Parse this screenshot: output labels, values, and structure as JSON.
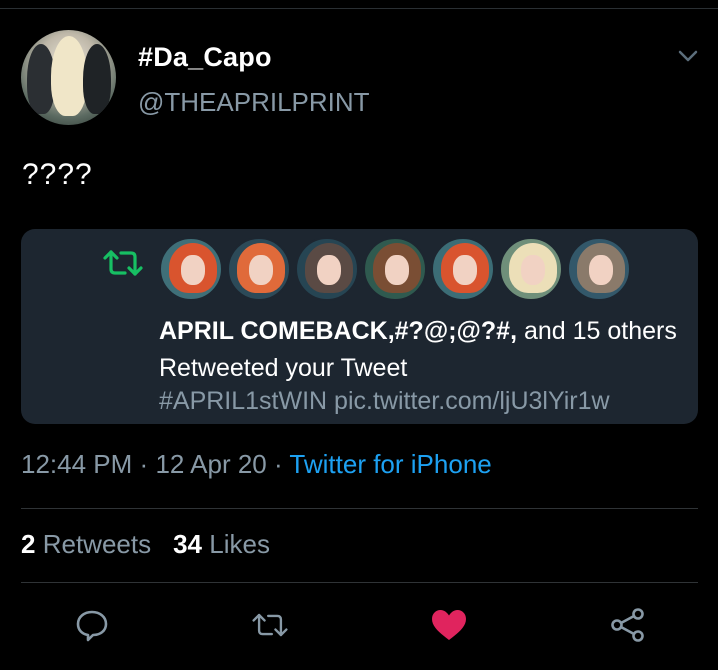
{
  "tweet": {
    "display_name": "#Da_Capo",
    "handle": "@THEAPRILPRINT",
    "text": "????"
  },
  "notification_card": {
    "actors": "APRIL COMEBACK,#?@;@?#,",
    "rest": " and 15 others Retweeted your Tweet",
    "link": "#APRIL1stWIN pic.twitter.com/ljU3lYir1w",
    "icon": "retweet-icon",
    "avatar_count": 7
  },
  "meta": {
    "time": "12:44 PM",
    "separator": "·",
    "date": "12 Apr 20",
    "source": "Twitter for iPhone"
  },
  "stats": {
    "retweets_count": "2",
    "retweets_label": "Retweets",
    "likes_count": "34",
    "likes_label": "Likes"
  },
  "actions": {
    "reply": "reply-icon",
    "retweet": "retweet-icon",
    "like": "heart-icon",
    "share": "share-icon"
  },
  "colors": {
    "background": "#000000",
    "card": "#1d2630",
    "muted": "#8899a6",
    "link": "#1da1f2",
    "retweet_green": "#17bf63",
    "like_pink": "#e0245e"
  }
}
